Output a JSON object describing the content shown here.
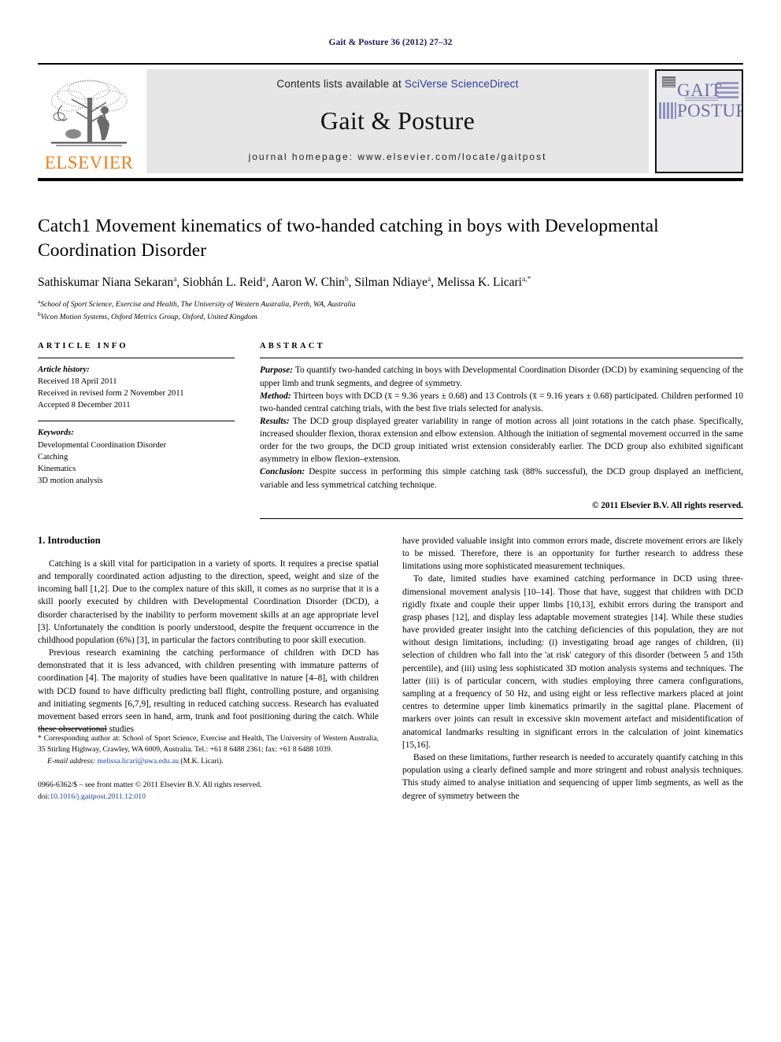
{
  "running_head": "Gait & Posture 36 (2012) 27–32",
  "masthead": {
    "contents_prefix": "Contents lists available at ",
    "sciencedirect": "SciVerse ScienceDirect",
    "journal_title": "Gait & Posture",
    "homepage": "journal homepage: www.elsevier.com/locate/gaitpost",
    "publisher": "ELSEVIER",
    "cover_line1": "GAIT",
    "cover_line2": "POSTURE",
    "link_color": "#2b3a9b",
    "publisher_color": "#F07C1A"
  },
  "article": {
    "title": "Catch1 Movement kinematics of two-handed catching in boys with Developmental Coordination Disorder",
    "authors": [
      {
        "name": "Sathiskumar Niana Sekaran",
        "marks": "a"
      },
      {
        "name": "Siobhán L. Reid",
        "marks": "a"
      },
      {
        "name": "Aaron W. Chin",
        "marks": "b"
      },
      {
        "name": "Silman Ndiaye",
        "marks": "a"
      },
      {
        "name": "Melissa K. Licari",
        "marks": "a,*"
      }
    ],
    "affiliations": [
      {
        "mark": "a",
        "text": "School of Sport Science, Exercise and Health, The University of Western Australia, Perth, WA, Australia"
      },
      {
        "mark": "b",
        "text": "Vicon Motion Systems, Oxford Metrics Group, Oxford, United Kingdom"
      }
    ]
  },
  "article_info": {
    "heading": "ARTICLE INFO",
    "history_label": "Article history:",
    "history": [
      "Received 18 April 2011",
      "Received in revised form 2 November 2011",
      "Accepted 8 December 2011"
    ],
    "keywords_label": "Keywords:",
    "keywords": [
      "Developmental Coordination Disorder",
      "Catching",
      "Kinematics",
      "3D motion analysis"
    ]
  },
  "abstract": {
    "heading": "ABSTRACT",
    "sections": [
      {
        "label": "Purpose:",
        "text": " To quantify two-handed catching in boys with Developmental Coordination Disorder (DCD) by examining sequencing of the upper limb and trunk segments, and degree of symmetry."
      },
      {
        "label": "Method:",
        "text": " Thirteen boys with DCD (x̄ = 9.36 years ± 0.68) and 13 Controls (x̄ = 9.16 years ± 0.68) participated. Children performed 10 two-handed central catching trials, with the best five trials selected for analysis."
      },
      {
        "label": "Results:",
        "text": " The DCD group displayed greater variability in range of motion across all joint rotations in the catch phase. Specifically, increased shoulder flexion, thorax extension and elbow extension. Although the initiation of segmental movement occurred in the same order for the two groups, the DCD group initiated wrist extension considerably earlier. The DCD group also exhibited significant asymmetry in elbow flexion–extension."
      },
      {
        "label": "Conclusion:",
        "text": " Despite success in performing this simple catching task (88% successful), the DCD group displayed an inefficient, variable and less symmetrical catching technique."
      }
    ],
    "copyright": "© 2011 Elsevier B.V. All rights reserved."
  },
  "body": {
    "section_heading": "1. Introduction",
    "left_paragraphs": [
      "Catching is a skill vital for participation in a variety of sports. It requires a precise spatial and temporally coordinated action adjusting to the direction, speed, weight and size of the incoming ball [1,2]. Due to the complex nature of this skill, it comes as no surprise that it is a skill poorly executed by children with Developmental Coordination Disorder (DCD), a disorder characterised by the inability to perform movement skills at an age appropriate level [3]. Unfortunately the condition is poorly understood, despite the frequent occurrence in the childhood population (6%) [3], in particular the factors contributing to poor skill execution.",
      "Previous research examining the catching performance of children with DCD has demonstrated that it is less advanced, with children presenting with immature patterns of coordination [4]. The majority of studies have been qualitative in nature [4–8], with children with DCD found to have difficulty predicting ball flight, controlling posture, and organising and initiating segments [6,7,9], resulting in reduced catching success. Research has evaluated movement based errors seen in hand, arm, trunk and foot positioning during the catch. While these observational studies"
    ],
    "right_paragraphs": [
      "have provided valuable insight into common errors made, discrete movement errors are likely to be missed. Therefore, there is an opportunity for further research to address these limitations using more sophisticated measurement techniques.",
      "To date, limited studies have examined catching performance in DCD using three-dimensional movement analysis [10–14]. Those that have, suggest that children with DCD rigidly fixate and couple their upper limbs [10,13], exhibit errors during the transport and grasp phases [12], and display less adaptable movement strategies [14]. While these studies have provided greater insight into the catching deficiencies of this population, they are not without design limitations, including: (i) investigating broad age ranges of children, (ii) selection of children who fall into the 'at risk' category of this disorder (between 5 and 15th percentile), and (iii) using less sophisticated 3D motion analysis systems and techniques. The latter (iii) is of particular concern, with studies employing three camera configurations, sampling at a frequency of 50 Hz, and using eight or less reflective markers placed at joint centres to determine upper limb kinematics primarily in the sagittal plane. Placement of markers over joints can result in excessive skin movement artefact and misidentification of anatomical landmarks resulting in significant errors in the calculation of joint kinematics [15,16].",
      "Based on these limitations, further research is needed to accurately quantify catching in this population using a clearly defined sample and more stringent and robust analysis techniques. This study aimed to analyse initiation and sequencing of upper limb segments, as well as the degree of symmetry between the"
    ]
  },
  "footnotes": {
    "corresponding": "* Corresponding author at: School of Sport Science, Exercise and Health, The University of Western Australia, 35 Stirling Highway, Crawley, WA 6009, Australia. Tel.: +61 8 6488 2361; fax: +61 8 6488 1039.",
    "email_label": "E-mail address:",
    "email_address": "melissa.licari@uwa.edu.au",
    "email_suffix": " (M.K. Licari).",
    "issn_line": "0966-6362/$ – see front matter © 2011 Elsevier B.V. All rights reserved.",
    "doi_prefix": "doi:",
    "doi": "10.1016/j.gaitpost.2011.12.010"
  }
}
